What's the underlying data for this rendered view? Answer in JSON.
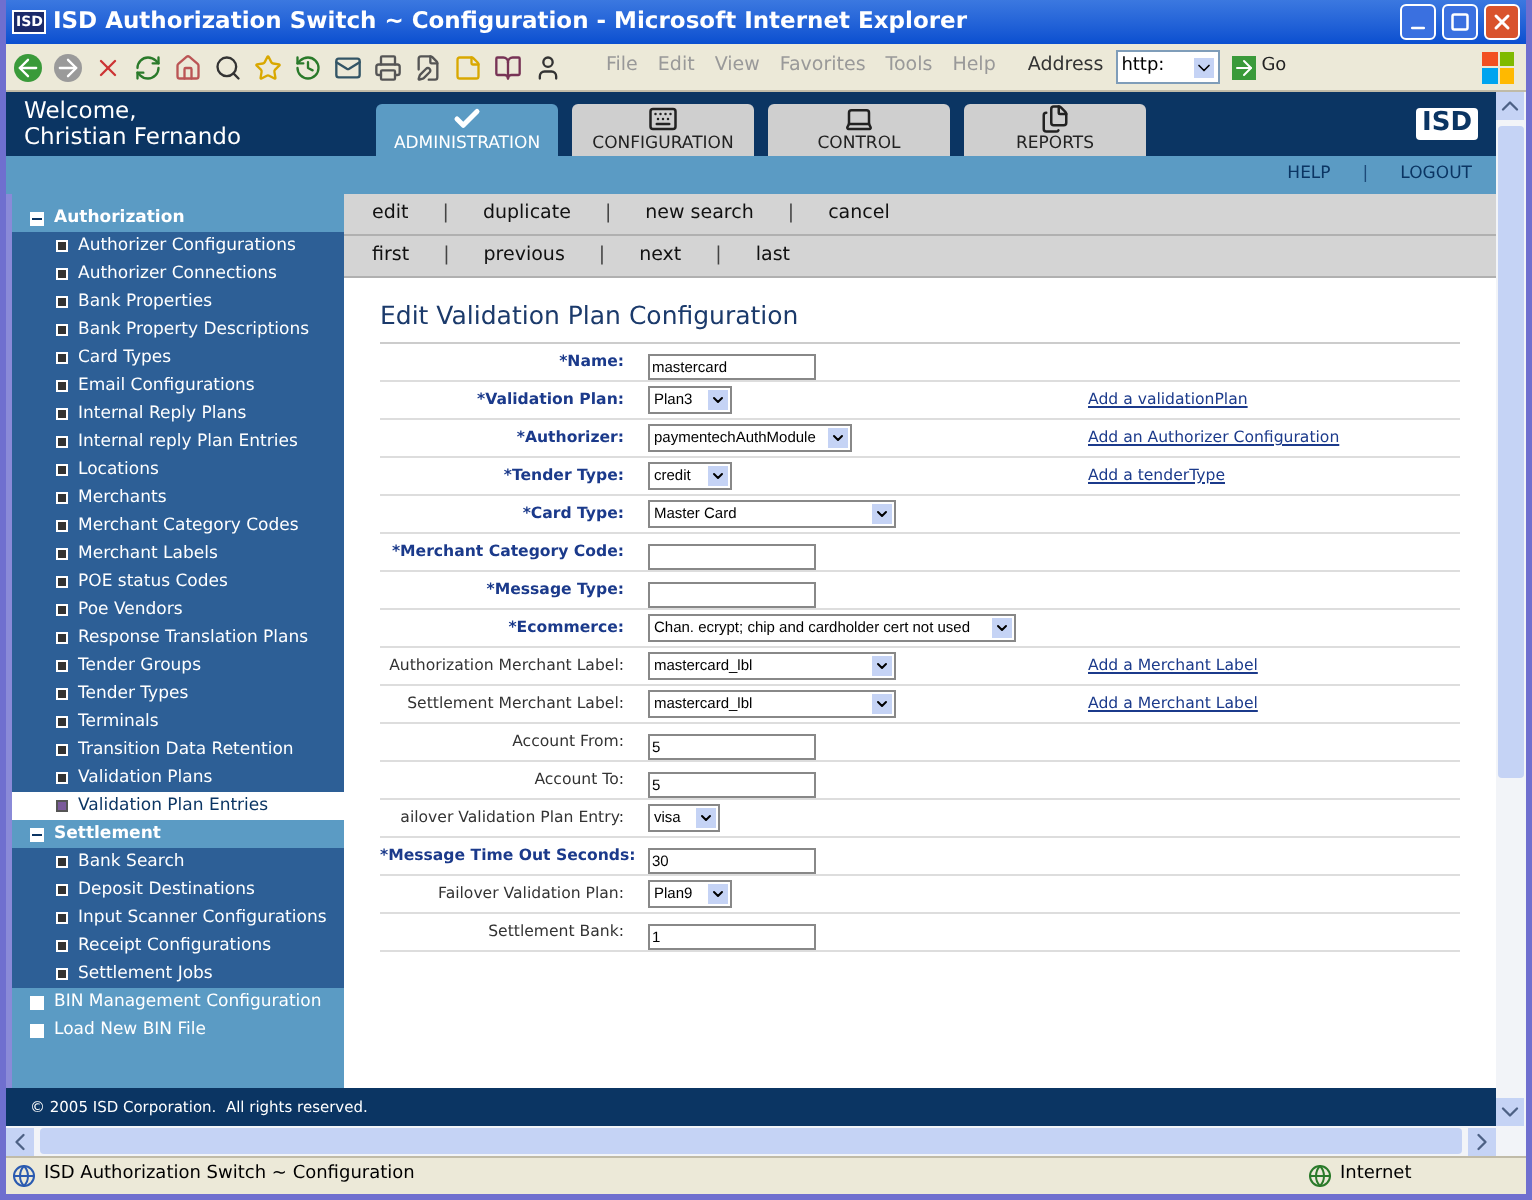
{
  "window": {
    "app_icon": "ISD",
    "title": "ISD Authorization Switch ~ Configuration - Microsoft Internet Explorer"
  },
  "toolbar": {
    "menu": [
      "File",
      "Edit",
      "View",
      "Favorites",
      "Tools",
      "Help"
    ],
    "address_label": "Address",
    "address_value": "http:",
    "go": "Go"
  },
  "header": {
    "welcome": [
      "Welcome,",
      "Christian Fernando"
    ],
    "logo": "ISD"
  },
  "tabs": [
    {
      "label": "ADMINISTRATION",
      "kind": "check",
      "selected": true
    },
    {
      "label": "CONFIGURATION",
      "kind": "keyboard",
      "selected": false
    },
    {
      "label": "CONTROL",
      "kind": "laptop",
      "selected": false
    },
    {
      "label": "REPORTS",
      "kind": "documents",
      "selected": false
    }
  ],
  "utility_links": [
    {
      "kind": "link",
      "label": "HELP"
    },
    {
      "kind": "sep",
      "label": "|"
    },
    {
      "kind": "link",
      "label": "LOGOUT"
    }
  ],
  "sidebar": {
    "items": [
      {
        "label": "Authorization",
        "expanded": true,
        "children": [
          {
            "label": "Authorizer Configurations",
            "selected": false
          },
          {
            "label": "Authorizer Connections",
            "selected": false
          },
          {
            "label": "Bank Properties",
            "selected": false
          },
          {
            "label": "Bank Property Descriptions",
            "selected": false
          },
          {
            "label": "Card Types",
            "selected": false
          },
          {
            "label": "Email Configurations",
            "selected": false
          },
          {
            "label": "Internal Reply Plans",
            "selected": false
          },
          {
            "label": "Internal reply Plan Entries",
            "selected": false
          },
          {
            "label": "Locations",
            "selected": false
          },
          {
            "label": "Merchants",
            "selected": false
          },
          {
            "label": "Merchant Category Codes",
            "selected": false
          },
          {
            "label": "Merchant Labels",
            "selected": false
          },
          {
            "label": "POE status Codes",
            "selected": false
          },
          {
            "label": "Poe Vendors",
            "selected": false
          },
          {
            "label": "Response Translation Plans",
            "selected": false
          },
          {
            "label": "Tender Groups",
            "selected": false
          },
          {
            "label": "Tender Types",
            "selected": false
          },
          {
            "label": "Terminals",
            "selected": false
          },
          {
            "label": "Transition Data Retention",
            "selected": false
          },
          {
            "label": "Validation Plans",
            "selected": false
          },
          {
            "label": "Validation Plan Entries",
            "selected": true
          }
        ]
      },
      {
        "label": "Settlement",
        "expanded": true,
        "children": [
          {
            "label": "Bank Search",
            "selected": false
          },
          {
            "label": "Deposit Destinations",
            "selected": false
          },
          {
            "label": "Input Scanner Configurations",
            "selected": false
          },
          {
            "label": "Receipt Configurations",
            "selected": false
          },
          {
            "label": "Settlement Jobs",
            "selected": false
          }
        ]
      },
      {
        "label": "BIN Management Configuration",
        "expanded": false
      },
      {
        "label": "Load New BIN File",
        "expanded": false
      }
    ]
  },
  "action_bar": [
    {
      "kind": "link",
      "label": "edit"
    },
    {
      "kind": "sep",
      "label": "|"
    },
    {
      "kind": "link",
      "label": "duplicate"
    },
    {
      "kind": "sep",
      "label": "|"
    },
    {
      "kind": "link",
      "label": "new search"
    },
    {
      "kind": "sep",
      "label": "|"
    },
    {
      "kind": "link",
      "label": "cancel"
    }
  ],
  "nav_bar": [
    {
      "kind": "link",
      "label": "first"
    },
    {
      "kind": "sep",
      "label": "|"
    },
    {
      "kind": "link",
      "label": "previous"
    },
    {
      "kind": "sep",
      "label": "|"
    },
    {
      "kind": "link",
      "label": "next"
    },
    {
      "kind": "sep",
      "label": "|"
    },
    {
      "kind": "link",
      "label": "last"
    }
  ],
  "form": {
    "title": "Edit Validation Plan Configuration",
    "rows": [
      {
        "label": "*Name:",
        "required": true,
        "kind": "text",
        "value": "mastercard"
      },
      {
        "label": "*Validation Plan:",
        "required": true,
        "kind": "select",
        "value": "Plan3",
        "link": "Add a validationPlan"
      },
      {
        "label": "*Authorizer:",
        "required": true,
        "kind": "select",
        "value": "paymentechAuthModule",
        "link": "Add an Authorizer Configuration"
      },
      {
        "label": "*Tender Type:",
        "required": true,
        "kind": "select",
        "value": "credit",
        "link": "Add a tenderType"
      },
      {
        "label": "*Card Type:",
        "required": true,
        "kind": "select",
        "value": "Master Card"
      },
      {
        "label": "*Merchant Category Code:",
        "required": true,
        "kind": "text"
      },
      {
        "label": "*Message Type:",
        "required": true,
        "kind": "text"
      },
      {
        "label": "*Ecommerce:",
        "required": true,
        "kind": "select",
        "value": "Chan. ecrypt; chip and cardholder cert not used"
      },
      {
        "label": "Authorization Merchant Label:",
        "required": false,
        "kind": "select",
        "value": "mastercard_lbl",
        "link": "Add a Merchant Label"
      },
      {
        "label": "Settlement Merchant Label:",
        "required": false,
        "kind": "select",
        "value": "mastercard_lbl",
        "link": "Add a Merchant Label"
      },
      {
        "label": "Account From:",
        "required": false,
        "kind": "text",
        "value": "5"
      },
      {
        "label": "Account To:",
        "required": false,
        "kind": "text",
        "value": "5"
      },
      {
        "label": "ailover Validation Plan Entry:",
        "required": false,
        "kind": "select",
        "value": "visa"
      },
      {
        "label": "*Message Time Out Seconds:",
        "required": true,
        "kind": "text",
        "value": "30"
      },
      {
        "label": "Failover Validation Plan:",
        "required": false,
        "kind": "select",
        "value": "Plan9"
      },
      {
        "label": "Settlement Bank:",
        "required": false,
        "kind": "text",
        "value": "1"
      }
    ]
  },
  "footer": {
    "text": "© 2005 ISD Corporation.  All rights reserved."
  },
  "status_bar": {
    "text": "ISD Authorization Switch ~ Configuration",
    "zone": "Internet"
  }
}
